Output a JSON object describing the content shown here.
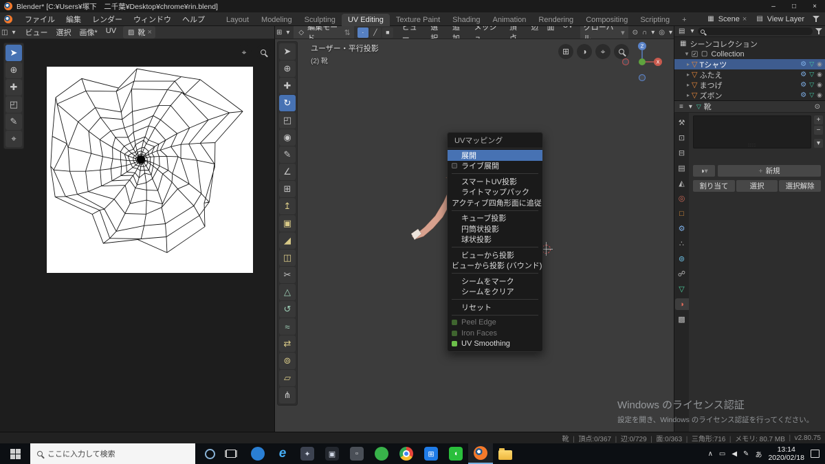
{
  "titlebar": {
    "title": "Blender* [C:¥Users¥塚下　二千葉¥Desktop¥chrome¥rin.blend]"
  },
  "icons": {
    "chevron_down": "▾",
    "updown_arrows": "⇅",
    "disclosure_closed": "▸",
    "disclosure_open": "▼",
    "check": "✓",
    "close": "×",
    "minimize": "–",
    "maximize": "□",
    "eye": "◉",
    "mesh_triangle": "▽",
    "wrench": "⚙",
    "plus": "+",
    "minus": "−",
    "image": "▨",
    "scene_box": "▦",
    "layers": "▤",
    "properties": "≡",
    "collection": "▢",
    "pin": "⊙",
    "grid": "⊞",
    "shading_sphere": "◑",
    "pan": "⌖",
    "editor_menu": "◫",
    "edit_mode": "◇",
    "pivot": "⊙",
    "magnet": "∩",
    "proportional": "◎",
    "browse_material": "◑",
    "grip": "::::"
  },
  "topbar": {
    "menus": [
      "ファイル",
      "編集",
      "レンダー",
      "ウィンドウ",
      "ヘルプ"
    ],
    "workspaces": [
      {
        "label": "Layout"
      },
      {
        "label": "Modeling"
      },
      {
        "label": "Sculpting"
      },
      {
        "label": "UV Editing",
        "active": true
      },
      {
        "label": "Texture Paint"
      },
      {
        "label": "Shading"
      },
      {
        "label": "Animation"
      },
      {
        "label": "Rendering"
      },
      {
        "label": "Compositing"
      },
      {
        "label": "Scripting"
      },
      {
        "label": "+"
      }
    ],
    "scene_label": "Scene",
    "view_layer_label": "View Layer"
  },
  "uv_editor": {
    "menus": [
      "ビュー",
      "選択",
      "画像*",
      "UV"
    ],
    "image_name": "靴",
    "tools": [
      {
        "name": "tweak",
        "glyph": "➤",
        "active": true
      },
      {
        "name": "cursor",
        "glyph": "⊕"
      },
      {
        "name": "move",
        "glyph": "✚"
      },
      {
        "name": "scale",
        "glyph": "◰"
      },
      {
        "name": "annotate",
        "glyph": "✎"
      },
      {
        "name": "grab",
        "glyph": "⌖"
      }
    ]
  },
  "viewport": {
    "mode": "編集モード",
    "menus": [
      "ビュー",
      "選択",
      "追加",
      "メッシュ",
      "頂点",
      "辺",
      "面",
      "UV"
    ],
    "select_modes": [
      {
        "name": "vertex",
        "glyph": "∙",
        "active": true
      },
      {
        "name": "edge",
        "glyph": "╱"
      },
      {
        "name": "face",
        "glyph": "■"
      }
    ],
    "orientation": "グローバル",
    "overlay1": "ユーザー・平行投影",
    "overlay2": "(2) 靴",
    "gizmo": {
      "x": "X",
      "z": "Z"
    },
    "tools": [
      {
        "name": "select-box",
        "glyph": "➤"
      },
      {
        "name": "cursor",
        "glyph": "⊕"
      },
      {
        "name": "move",
        "glyph": "✚"
      },
      {
        "name": "rotate",
        "glyph": "↻",
        "active": true
      },
      {
        "name": "scale",
        "glyph": "◰"
      },
      {
        "name": "transform",
        "glyph": "◉"
      },
      {
        "name": "annotate",
        "glyph": "✎"
      },
      {
        "name": "measure",
        "glyph": "∠"
      },
      {
        "name": "add-cube",
        "glyph": "⊞"
      },
      {
        "name": "extrude",
        "glyph": "↥",
        "color": "#d8c987"
      },
      {
        "name": "inset",
        "glyph": "▣",
        "color": "#d8c987"
      },
      {
        "name": "bevel",
        "glyph": "◢",
        "color": "#d8c987"
      },
      {
        "name": "loop-cut",
        "glyph": "◫",
        "color": "#d8c987"
      },
      {
        "name": "knife",
        "glyph": "✂"
      },
      {
        "name": "poly-build",
        "glyph": "△",
        "color": "#9fd0b8"
      },
      {
        "name": "spin",
        "glyph": "↺",
        "color": "#9fd0b8"
      },
      {
        "name": "smooth",
        "glyph": "≈",
        "color": "#9fd0b8"
      },
      {
        "name": "edge-slide",
        "glyph": "⇄",
        "color": "#d8c987"
      },
      {
        "name": "shrink-fatten",
        "glyph": "⊚",
        "color": "#d8c987"
      },
      {
        "name": "shear",
        "glyph": "▱",
        "color": "#d8c987"
      },
      {
        "name": "rip",
        "glyph": "⋔"
      }
    ]
  },
  "context_menu": {
    "title": "UVマッピング",
    "items": [
      {
        "label": "展開",
        "active": true
      },
      {
        "label": "ライブ展開",
        "checkbox": true
      },
      {
        "sep": true
      },
      {
        "label": "スマートUV投影"
      },
      {
        "label": "ライトマップパック"
      },
      {
        "label": "アクティブ四角形面に追従"
      },
      {
        "sep": true
      },
      {
        "label": "キューブ投影"
      },
      {
        "label": "円筒状投影"
      },
      {
        "label": "球状投影"
      },
      {
        "sep": true
      },
      {
        "label": "ビューから投影"
      },
      {
        "label": "ビューから投影 (バウンド)"
      },
      {
        "sep": true
      },
      {
        "label": "シームをマーク"
      },
      {
        "label": "シームをクリア"
      },
      {
        "sep": true
      },
      {
        "label": "リセット"
      },
      {
        "sep": true
      },
      {
        "label": "Peel Edge",
        "icon": true,
        "disabled": true
      },
      {
        "label": "Iron Faces",
        "icon": true,
        "disabled": true
      },
      {
        "label": "UV Smoothing",
        "icon": true
      }
    ]
  },
  "outliner": {
    "scene_collection": "シーンコレクション",
    "collection": "Collection",
    "objects": [
      {
        "label": "Tシャツ",
        "selected": true
      },
      {
        "label": "ふたえ"
      },
      {
        "label": "まつげ"
      },
      {
        "label": "ズボン"
      }
    ]
  },
  "properties": {
    "object_name": "靴",
    "tabs": [
      {
        "name": "tool",
        "glyph": "⚒"
      },
      {
        "name": "render",
        "glyph": "⊡"
      },
      {
        "name": "output",
        "glyph": "⊟"
      },
      {
        "name": "view-layer",
        "glyph": "▤"
      },
      {
        "name": "scene",
        "glyph": "◭"
      },
      {
        "name": "world",
        "glyph": "◎",
        "color": "#cf6a58"
      },
      {
        "name": "object",
        "glyph": "□",
        "color": "#e8973e"
      },
      {
        "name": "modifiers",
        "glyph": "⚙",
        "color": "#7fb0e8"
      },
      {
        "name": "particles",
        "glyph": "∴"
      },
      {
        "name": "physics",
        "glyph": "⊚",
        "color": "#6fc3e8"
      },
      {
        "name": "constraints",
        "glyph": "☍"
      },
      {
        "name": "data",
        "glyph": "▽",
        "color": "#4ecf9f"
      },
      {
        "name": "material",
        "glyph": "◑",
        "color": "#e06a5a",
        "active": true
      },
      {
        "name": "texture",
        "glyph": "▩"
      }
    ],
    "new_button": "新規",
    "assign_button": "割り当て",
    "select_button": "選択",
    "deselect_button": "選択解除"
  },
  "statusbar": {
    "segments": [
      "靴",
      "頂点:0/367",
      "辺:0/729",
      "面:0/363",
      "三角形:716",
      "メモリ: 80.7 MB",
      "v2.80.75"
    ]
  },
  "watermark": {
    "line1": "Windows のライセンス認証",
    "line2": "設定を開き、Windows のライセンス認証を行ってください。"
  },
  "taskbar": {
    "search_placeholder": "ここに入力して検索",
    "apps": [
      {
        "name": "people",
        "style": "circle",
        "bg": "#2a7fd4"
      },
      {
        "name": "edge",
        "style": "glyph",
        "glyph": "e",
        "color": "#46aef7"
      },
      {
        "name": "dark-app",
        "style": "square",
        "bg": "#3c4250",
        "glyph": "✦",
        "color": "#cfd6e4"
      },
      {
        "name": "camera",
        "style": "square",
        "bg": "#23272e",
        "glyph": "▣",
        "color": "#cfd6e4"
      },
      {
        "name": "gray-app",
        "style": "square",
        "bg": "#4a4f57",
        "glyph": "▫",
        "color": "#e8e8e8"
      },
      {
        "name": "green-app",
        "style": "circle",
        "bg": "#38b24a"
      },
      {
        "name": "chrome",
        "style": "chrome"
      },
      {
        "name": "store",
        "style": "square",
        "bg": "#1f7ce8",
        "glyph": "⊞",
        "color": "#ffffff"
      },
      {
        "name": "line",
        "style": "square",
        "bg": "#2abf3c",
        "glyph": "◖",
        "color": "#ffffff"
      },
      {
        "name": "blender",
        "style": "blender",
        "active": true
      },
      {
        "name": "explorer",
        "style": "folder"
      }
    ],
    "tray": [
      {
        "name": "hidden-icons",
        "glyph": "∧"
      },
      {
        "name": "display",
        "glyph": "▭"
      },
      {
        "name": "volume",
        "glyph": "◀"
      },
      {
        "name": "pen",
        "glyph": "✎"
      },
      {
        "name": "ime",
        "glyph": "あ"
      }
    ],
    "clock": {
      "time": "13:14",
      "date": "2020/02/18"
    }
  }
}
